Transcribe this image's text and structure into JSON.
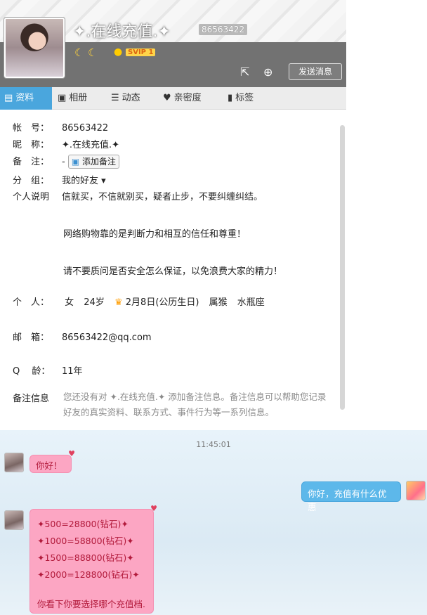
{
  "profile": {
    "nickname": "✦.在线充值.✦",
    "qq_number": "86563422",
    "vip_label": "SVIP 1",
    "send_message": "发送消息",
    "tabs": [
      {
        "label": "资料",
        "icon": "id-card-icon"
      },
      {
        "label": "相册",
        "icon": "album-icon"
      },
      {
        "label": "动态",
        "icon": "feed-icon"
      },
      {
        "label": "亲密度",
        "icon": "heart-icon"
      },
      {
        "label": "标签",
        "icon": "bookmark-icon"
      }
    ],
    "fields": {
      "account_label": "帐　号：",
      "account": "86563422",
      "nick_label": "昵　称：",
      "nick": "✦.在线充值.✦",
      "memo_label": "备　注：",
      "memo_value": "-",
      "memo_button": "添加备注",
      "group_label": "分　组：",
      "group": "我的好友 ▾",
      "desc_label": "个人说明",
      "desc_1": "信就买，不信就别买，疑者止步，不要纠缠纠结。",
      "desc_2": "网络购物靠的是判断力和相互的信任和尊重！",
      "desc_3": "请不要质问是否安全怎么保证，以免浪费大家的精力！",
      "personal_label": "个　人：",
      "gender": "女",
      "age": "24岁",
      "birthday": "2月8日(公历生日)",
      "zodiac": "属猴",
      "constellation": "水瓶座",
      "email_label": "邮　箱：",
      "email": "86563422@qq.com",
      "qage_label": "Q　 龄：",
      "qage": "11年",
      "remark_label": "备注信息",
      "remark_desc": "您还没有对 ✦.在线充值.✦ 添加备注信息。备注信息可以帮助您记录好友的真实资料、联系方式、事件行为等一系列信息。"
    }
  },
  "chat": {
    "timestamp": "11:45:01",
    "messages": [
      {
        "from": "friend",
        "text": "你好！"
      },
      {
        "from": "self",
        "text": "你好，充值有什么优惠"
      },
      {
        "from": "friend",
        "lines": [
          "✦500=28800(钻石)✦",
          "✦1000=58800(钻石)✦",
          "✦1500=88800(钻石)✦",
          "✦2000=128800(钻石)✦"
        ],
        "tail": "你看下你要选择哪个充值档."
      }
    ]
  }
}
